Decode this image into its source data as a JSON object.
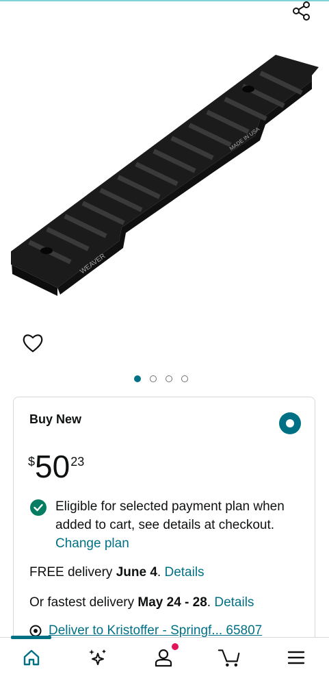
{
  "product": {
    "image_text": [
      "WEAVER",
      "MADE IN USA"
    ],
    "image_count": 4,
    "active_image": 1
  },
  "buy_box": {
    "title": "Buy New",
    "price": {
      "symbol": "$",
      "whole": "50",
      "fraction": "23"
    },
    "eligible": {
      "text": "Eligible for selected payment plan when added to cart, see details at checkout.",
      "link": "Change plan"
    },
    "delivery": {
      "prefix": "FREE delivery ",
      "date": "June 4",
      "suffix": ". ",
      "link": "Details"
    },
    "fastest": {
      "prefix": "Or fastest delivery ",
      "date": "May 24 - 28",
      "suffix": ". ",
      "link": "Details"
    },
    "deliver_to": "Deliver to Kristoffer - Springf... 65807"
  },
  "colors": {
    "accent": "#007185",
    "check": "#067d62",
    "badge": "#e3145a"
  },
  "icons": {
    "share": "share-icon",
    "wishlist": "heart-icon",
    "location": "location-pin-icon",
    "nav": [
      "home-icon",
      "sparkle-icon",
      "account-icon",
      "cart-icon",
      "menu-icon"
    ]
  }
}
